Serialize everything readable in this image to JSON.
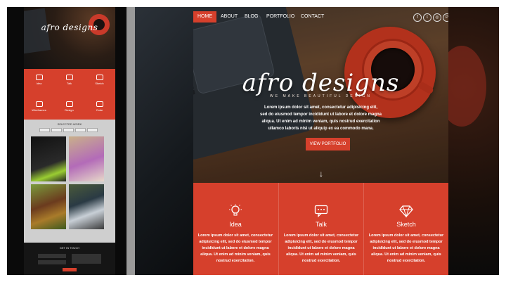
{
  "site": {
    "nav": [
      {
        "label": "HOME",
        "active": true
      },
      {
        "label": "ABOUT",
        "active": false
      },
      {
        "label": "BLOG",
        "active": false
      },
      {
        "label": "PORTFOLIO",
        "active": false
      },
      {
        "label": "CONTACT",
        "active": false
      }
    ],
    "social": [
      {
        "icon": "facebook-icon",
        "glyph": "f"
      },
      {
        "icon": "twitter-icon",
        "glyph": "t"
      },
      {
        "icon": "instagram-icon",
        "glyph": "◎"
      },
      {
        "icon": "pinterest-icon",
        "glyph": "P"
      }
    ],
    "hero": {
      "logo": "afro designs",
      "tagline": "WE MAKE BEAUTIFUL DESIGN",
      "text": "Lorem ipsum dolor sit amet, consectetur adipisicing elit, sed do eiusmod tempor incididunt ut labore et dolore magna aliqua. Ut enim ad minim veniam, quis nostrud exercitation ullamco laboris nisi ut aliquip ex ea commodo mana.",
      "cta": "VIEW PORTFOLIO",
      "arrow": "↓"
    },
    "features": [
      {
        "icon": "lightbulb-icon",
        "title": "Idea",
        "text": "Lorem ipsum dolor sit amet, consectetur adipisicing elit, sed do eiusmod tempor incididunt ut labore et dolore magna aliqua. Ut enim ad minim veniam, quis nostrud exercitation."
      },
      {
        "icon": "chat-bubble-icon",
        "title": "Talk",
        "text": "Lorem ipsum dolor sit amet, consectetur adipisicing elit, sed do eiusmod tempor incididunt ut labore et dolore magna aliqua. Ut enim ad minim veniam, quis nostrud exercitation."
      },
      {
        "icon": "diamond-icon",
        "title": "Sketch",
        "text": "Lorem ipsum dolor sit amet, consectetur adipisicing elit, sed do eiusmod tempor incididunt ut labore et dolore magna aliqua. Ut enim ad minim veniam, quis nostrud exercitation."
      }
    ]
  },
  "mini": {
    "title": "afro designs",
    "features_row1": [
      "Idea",
      "Talk",
      "Sketch"
    ],
    "features_row2": [
      "Wireframes",
      "Design",
      "Code"
    ],
    "work_title": "SELECTED WORK",
    "footer_title": "GET IN TOUCH"
  },
  "colors": {
    "accent": "#d6402c"
  }
}
